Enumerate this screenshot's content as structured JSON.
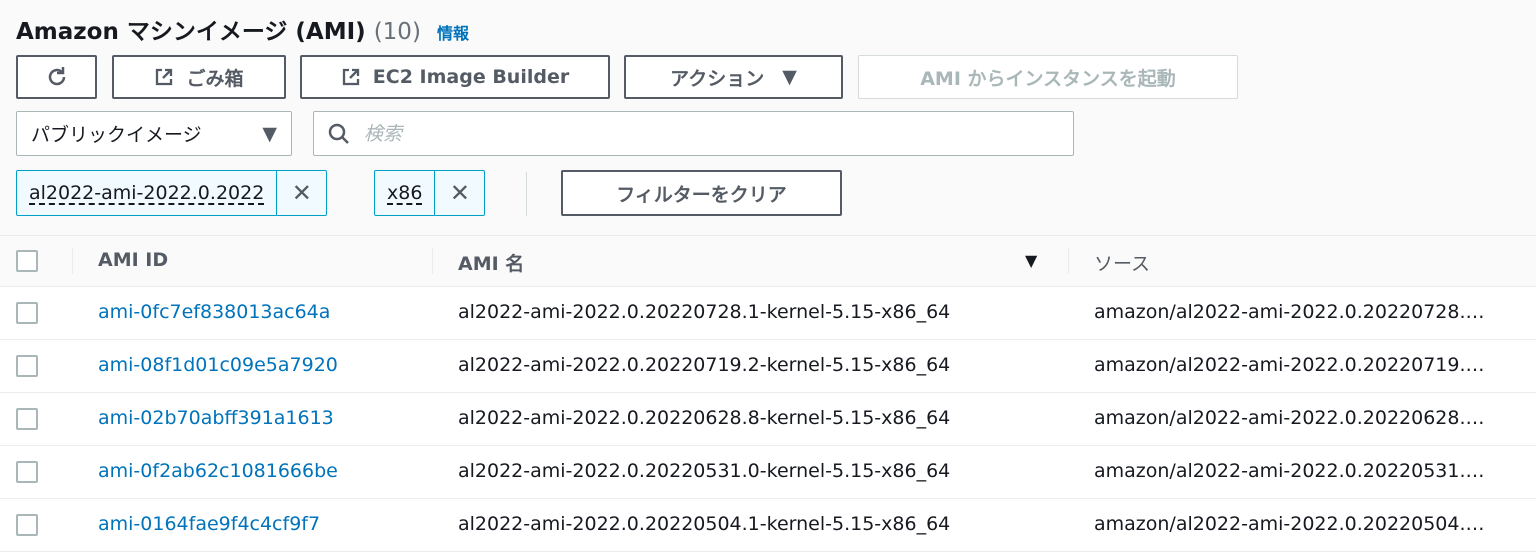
{
  "header": {
    "title": "Amazon マシンイメージ (AMI)",
    "count": "(10)",
    "info": "情報"
  },
  "toolbar": {
    "refresh_icon": "refresh-icon",
    "recycle_bin": "ごみ箱",
    "image_builder": "EC2 Image Builder",
    "actions": "アクション",
    "launch": "AMI からインスタンスを起動"
  },
  "filter": {
    "image_type": "パブリックイメージ",
    "search_placeholder": "検索",
    "search_value": "",
    "tokens": [
      "al2022-ami-2022.0.2022",
      "x86"
    ],
    "clear": "フィルターをクリア"
  },
  "table": {
    "columns": [
      "AMI ID",
      "AMI 名",
      "ソース"
    ],
    "rows": [
      {
        "id": "ami-0fc7ef838013ac64a",
        "name": "al2022-ami-2022.0.20220728.1-kernel-5.15-x86_64",
        "source": "amazon/al2022-ami-2022.0.20220728.…"
      },
      {
        "id": "ami-08f1d01c09e5a7920",
        "name": "al2022-ami-2022.0.20220719.2-kernel-5.15-x86_64",
        "source": "amazon/al2022-ami-2022.0.20220719.…"
      },
      {
        "id": "ami-02b70abff391a1613",
        "name": "al2022-ami-2022.0.20220628.8-kernel-5.15-x86_64",
        "source": "amazon/al2022-ami-2022.0.20220628.…"
      },
      {
        "id": "ami-0f2ab62c1081666be",
        "name": "al2022-ami-2022.0.20220531.0-kernel-5.15-x86_64",
        "source": "amazon/al2022-ami-2022.0.20220531.…"
      },
      {
        "id": "ami-0164fae9f4c4cf9f7",
        "name": "al2022-ami-2022.0.20220504.1-kernel-5.15-x86_64",
        "source": "amazon/al2022-ami-2022.0.20220504.…"
      }
    ]
  }
}
